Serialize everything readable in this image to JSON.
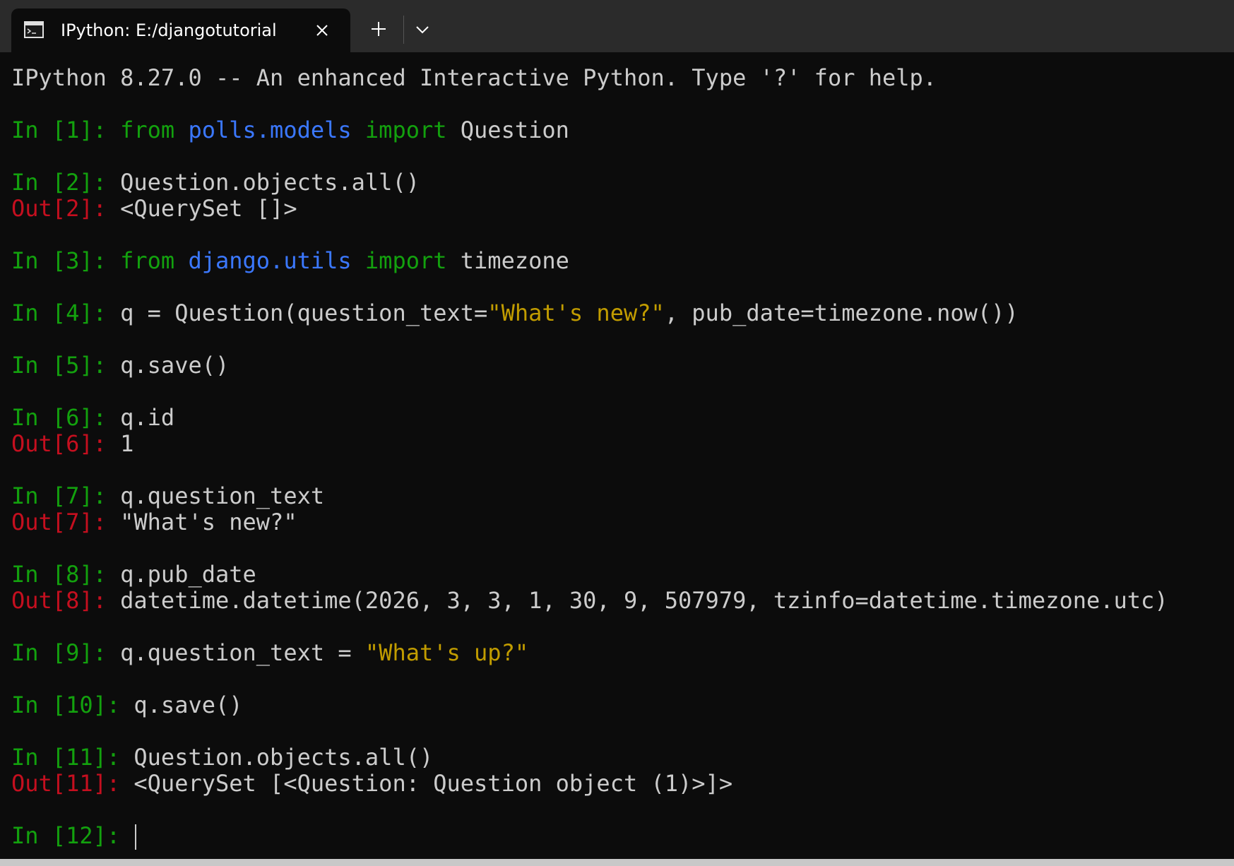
{
  "window": {
    "tab_title": "IPython: E:/djangotutorial",
    "icons": {
      "tab": "terminal-icon",
      "close": "close-icon",
      "new_tab": "plus-icon",
      "dropdown": "chevron-down-icon"
    }
  },
  "colors": {
    "background": "#0c0c0c",
    "prompt_in": "#13a10e",
    "prompt_out": "#c50f1f",
    "module": "#3b78ff",
    "string": "#c19c00",
    "text": "#cccccc"
  },
  "terminal": {
    "banner": "IPython 8.27.0 -- An enhanced Interactive Python. Type '?' for help.",
    "cells": [
      {
        "in_prompt": "In [1]: ",
        "code": [
          {
            "t": "from",
            "c": "g"
          },
          {
            "t": " ",
            "c": "d"
          },
          {
            "t": "polls.models",
            "c": "b"
          },
          {
            "t": " ",
            "c": "d"
          },
          {
            "t": "import",
            "c": "g"
          },
          {
            "t": " Question",
            "c": "d"
          }
        ]
      },
      {
        "in_prompt": "In [2]: ",
        "code": [
          {
            "t": "Question.objects.all()",
            "c": "d"
          }
        ],
        "out_prompt": "Out[2]: ",
        "output": "<QuerySet []>"
      },
      {
        "in_prompt": "In [3]: ",
        "code": [
          {
            "t": "from",
            "c": "g"
          },
          {
            "t": " ",
            "c": "d"
          },
          {
            "t": "django.utils",
            "c": "b"
          },
          {
            "t": " ",
            "c": "d"
          },
          {
            "t": "import",
            "c": "g"
          },
          {
            "t": " timezone",
            "c": "d"
          }
        ]
      },
      {
        "in_prompt": "In [4]: ",
        "code": [
          {
            "t": "q = Question(question_text=",
            "c": "d"
          },
          {
            "t": "\"What's new?\"",
            "c": "y"
          },
          {
            "t": ", pub_date=timezone.now())",
            "c": "d"
          }
        ]
      },
      {
        "in_prompt": "In [5]: ",
        "code": [
          {
            "t": "q.save()",
            "c": "d"
          }
        ]
      },
      {
        "in_prompt": "In [6]: ",
        "code": [
          {
            "t": "q.id",
            "c": "d"
          }
        ],
        "out_prompt": "Out[6]: ",
        "output": "1"
      },
      {
        "in_prompt": "In [7]: ",
        "code": [
          {
            "t": "q.question_text",
            "c": "d"
          }
        ],
        "out_prompt": "Out[7]: ",
        "output": "\"What's new?\""
      },
      {
        "in_prompt": "In [8]: ",
        "code": [
          {
            "t": "q.pub_date",
            "c": "d"
          }
        ],
        "out_prompt": "Out[8]: ",
        "output": "datetime.datetime(2026, 3, 3, 1, 30, 9, 507979, tzinfo=datetime.timezone.utc)"
      },
      {
        "in_prompt": "In [9]: ",
        "code": [
          {
            "t": "q.question_text = ",
            "c": "d"
          },
          {
            "t": "\"What's up?\"",
            "c": "y"
          }
        ]
      },
      {
        "in_prompt": "In [10]: ",
        "code": [
          {
            "t": "q.save()",
            "c": "d"
          }
        ]
      },
      {
        "in_prompt": "In [11]: ",
        "code": [
          {
            "t": "Question.objects.all()",
            "c": "d"
          }
        ],
        "out_prompt": "Out[11]: ",
        "output": "<QuerySet [<Question: Question object (1)>]>"
      }
    ],
    "current_prompt": "In [12]: "
  }
}
